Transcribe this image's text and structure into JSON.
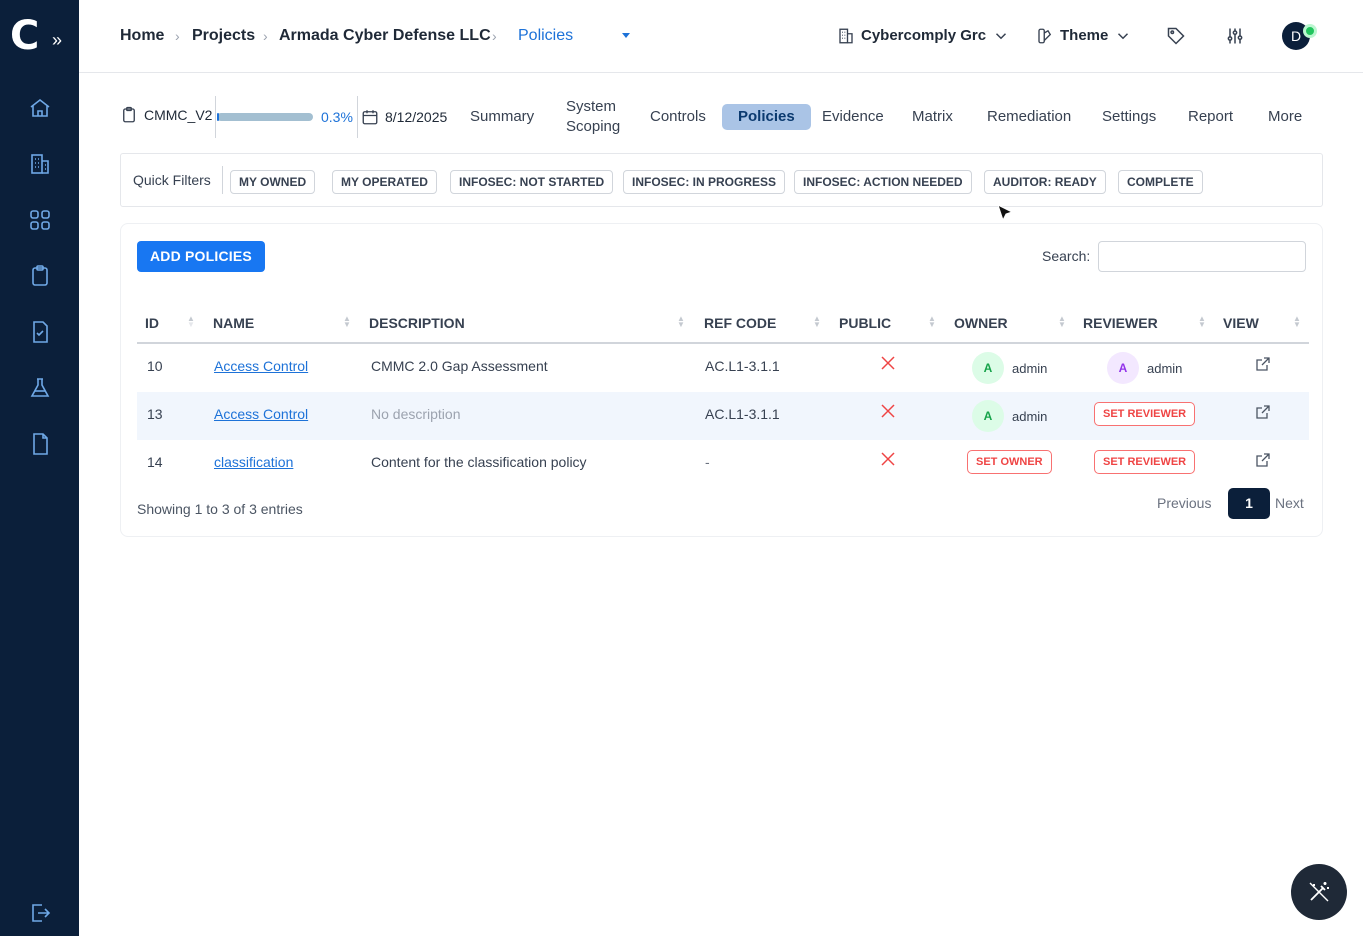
{
  "sidebar": {
    "logo": "C",
    "expand_icon": "double-chevron-right-icon",
    "items": [
      "home-icon",
      "building-icon",
      "grid-icon",
      "clipboard-icon",
      "file-check-icon",
      "flask-icon",
      "file-icon"
    ],
    "logout_icon": "logout-icon"
  },
  "breadcrumb": {
    "home": "Home",
    "projects": "Projects",
    "company": "Armada Cyber Defense LLC",
    "current": "Policies"
  },
  "header": {
    "org": "Cybercomply Grc",
    "theme": "Theme",
    "avatar_initial": "D"
  },
  "project": {
    "name": "CMMC_V2",
    "progress": 0.3,
    "progress_label": "0.3%",
    "date": "8/12/2025",
    "tabs": [
      "Summary",
      "System Scoping",
      "Controls",
      "Policies",
      "Evidence",
      "Matrix",
      "Remediation",
      "Settings",
      "Report",
      "More"
    ],
    "active_tab": "Policies"
  },
  "filters": {
    "label": "Quick Filters",
    "chips": [
      "MY OWNED",
      "MY OPERATED",
      "INFOSEC: NOT STARTED",
      "INFOSEC: IN PROGRESS",
      "INFOSEC: ACTION NEEDED",
      "AUDITOR: READY",
      "COMPLETE"
    ]
  },
  "toolbar": {
    "add_label": "ADD POLICIES",
    "search_label": "Search:",
    "search_value": ""
  },
  "table": {
    "columns": [
      "ID",
      "NAME",
      "DESCRIPTION",
      "REF CODE",
      "PUBLIC",
      "OWNER",
      "REVIEWER",
      "VIEW"
    ],
    "rows": [
      {
        "id": "10",
        "name": "Access Control",
        "description": "CMMC 2.0 Gap Assessment",
        "ref_code": "AC.L1-3.1.1",
        "owner": "admin",
        "owner_initial": "A",
        "reviewer": "admin",
        "reviewer_initial": "A"
      },
      {
        "id": "13",
        "name": "Access Control",
        "description": "No description",
        "ref_code": "AC.L1-3.1.1",
        "owner": "admin",
        "owner_initial": "A",
        "reviewer_action": "SET REVIEWER"
      },
      {
        "id": "14",
        "name": "classification",
        "description": "Content for the classification policy",
        "ref_code": "-",
        "owner_action": "SET OWNER",
        "reviewer_action": "SET REVIEWER"
      }
    ]
  },
  "pagination": {
    "summary": "Showing 1 to 3 of 3 entries",
    "previous": "Previous",
    "page": "1",
    "next": "Next"
  },
  "colors": {
    "sidebar": "#0b1f3a",
    "accent": "#1877f2",
    "danger": "#ef4444"
  }
}
